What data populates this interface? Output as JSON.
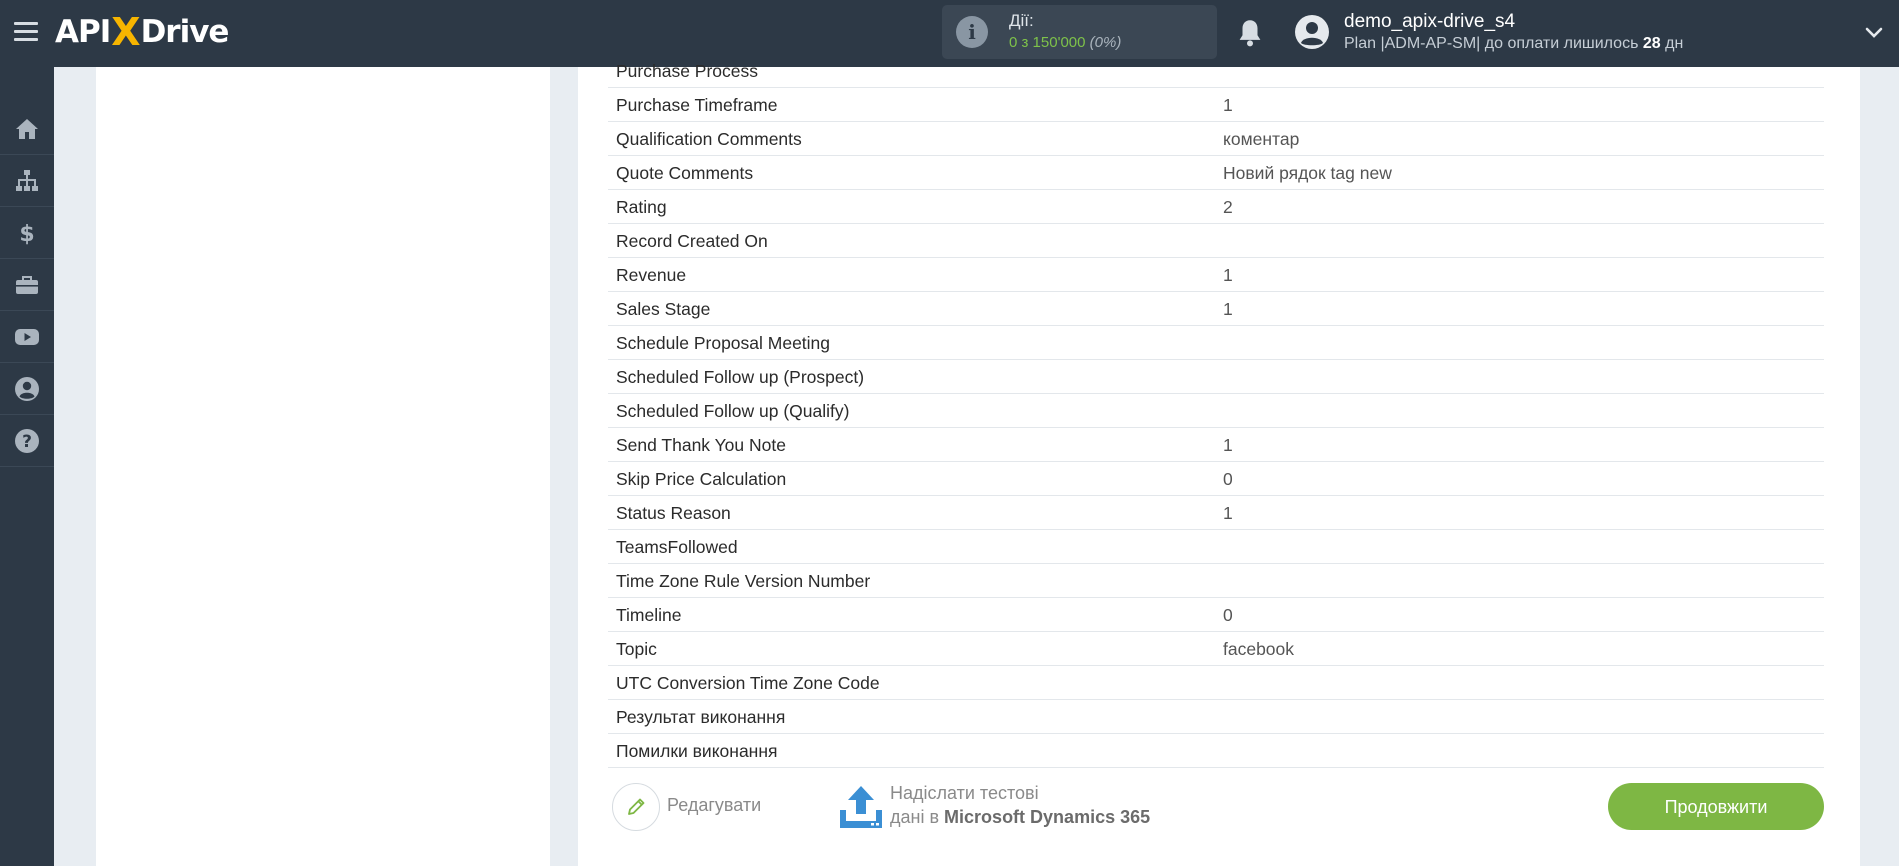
{
  "header": {
    "logo_prefix": "API",
    "logo_x": "X",
    "logo_suffix": "Drive",
    "actions_label": "Дії:",
    "actions_value": "0 з 150'000",
    "actions_percent": "(0%)",
    "username": "demo_apix-drive_s4",
    "plan_text": "Plan |ADM-AP-SM| до оплати лишилось",
    "plan_days": "28",
    "plan_days_unit": "дн"
  },
  "sidebar": {
    "items": [
      "home-icon",
      "sitemap-icon",
      "dollar-icon",
      "briefcase-icon",
      "youtube-icon",
      "user-icon",
      "help-icon"
    ]
  },
  "table": {
    "rows": [
      {
        "key": "Purchase Process",
        "value": ""
      },
      {
        "key": "Purchase Timeframe",
        "value": "1"
      },
      {
        "key": "Qualification Comments",
        "value": "коментар"
      },
      {
        "key": "Quote Comments",
        "value": "Новий рядок tag new"
      },
      {
        "key": "Rating",
        "value": "2"
      },
      {
        "key": "Record Created On",
        "value": ""
      },
      {
        "key": "Revenue",
        "value": "1"
      },
      {
        "key": "Sales Stage",
        "value": "1"
      },
      {
        "key": "Schedule Proposal Meeting",
        "value": ""
      },
      {
        "key": "Scheduled Follow up (Prospect)",
        "value": ""
      },
      {
        "key": "Scheduled Follow up (Qualify)",
        "value": ""
      },
      {
        "key": "Send Thank You Note",
        "value": "1"
      },
      {
        "key": "Skip Price Calculation",
        "value": "0"
      },
      {
        "key": "Status Reason",
        "value": "1"
      },
      {
        "key": "TeamsFollowed",
        "value": ""
      },
      {
        "key": "Time Zone Rule Version Number",
        "value": ""
      },
      {
        "key": "Timeline",
        "value": "0"
      },
      {
        "key": "Topic",
        "value": "facebook"
      },
      {
        "key": "UTC Conversion Time Zone Code",
        "value": ""
      },
      {
        "key": "Результат виконання",
        "value": ""
      },
      {
        "key": "Помилки виконання",
        "value": ""
      }
    ]
  },
  "footer": {
    "edit_label": "Редагувати",
    "send_line1": "Надіслати тестові",
    "send_line2_prefix": "дані в",
    "send_target": "Microsoft Dynamics 365",
    "continue_label": "Продовжити"
  },
  "colors": {
    "topbar": "#2d3946",
    "accent_green": "#7eb744",
    "logo_x": "#f7b500"
  }
}
